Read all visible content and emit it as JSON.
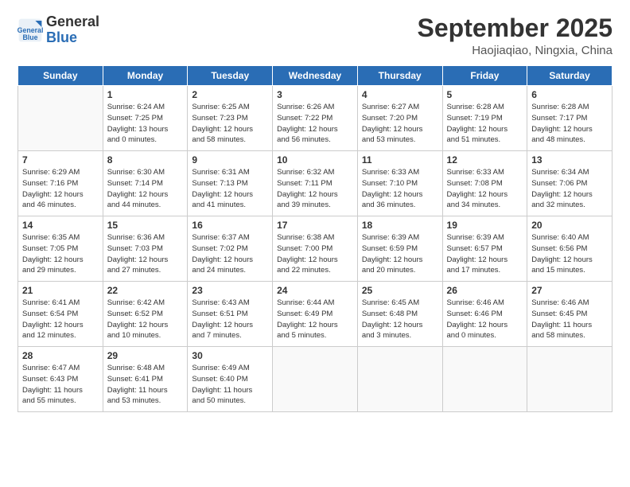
{
  "logo": {
    "line1": "General",
    "line2": "Blue"
  },
  "title": "September 2025",
  "subtitle": "Haojiaqiao, Ningxia, China",
  "days_of_week": [
    "Sunday",
    "Monday",
    "Tuesday",
    "Wednesday",
    "Thursday",
    "Friday",
    "Saturday"
  ],
  "weeks": [
    [
      {
        "day": "",
        "info": ""
      },
      {
        "day": "1",
        "info": "Sunrise: 6:24 AM\nSunset: 7:25 PM\nDaylight: 13 hours\nand 0 minutes."
      },
      {
        "day": "2",
        "info": "Sunrise: 6:25 AM\nSunset: 7:23 PM\nDaylight: 12 hours\nand 58 minutes."
      },
      {
        "day": "3",
        "info": "Sunrise: 6:26 AM\nSunset: 7:22 PM\nDaylight: 12 hours\nand 56 minutes."
      },
      {
        "day": "4",
        "info": "Sunrise: 6:27 AM\nSunset: 7:20 PM\nDaylight: 12 hours\nand 53 minutes."
      },
      {
        "day": "5",
        "info": "Sunrise: 6:28 AM\nSunset: 7:19 PM\nDaylight: 12 hours\nand 51 minutes."
      },
      {
        "day": "6",
        "info": "Sunrise: 6:28 AM\nSunset: 7:17 PM\nDaylight: 12 hours\nand 48 minutes."
      }
    ],
    [
      {
        "day": "7",
        "info": "Sunrise: 6:29 AM\nSunset: 7:16 PM\nDaylight: 12 hours\nand 46 minutes."
      },
      {
        "day": "8",
        "info": "Sunrise: 6:30 AM\nSunset: 7:14 PM\nDaylight: 12 hours\nand 44 minutes."
      },
      {
        "day": "9",
        "info": "Sunrise: 6:31 AM\nSunset: 7:13 PM\nDaylight: 12 hours\nand 41 minutes."
      },
      {
        "day": "10",
        "info": "Sunrise: 6:32 AM\nSunset: 7:11 PM\nDaylight: 12 hours\nand 39 minutes."
      },
      {
        "day": "11",
        "info": "Sunrise: 6:33 AM\nSunset: 7:10 PM\nDaylight: 12 hours\nand 36 minutes."
      },
      {
        "day": "12",
        "info": "Sunrise: 6:33 AM\nSunset: 7:08 PM\nDaylight: 12 hours\nand 34 minutes."
      },
      {
        "day": "13",
        "info": "Sunrise: 6:34 AM\nSunset: 7:06 PM\nDaylight: 12 hours\nand 32 minutes."
      }
    ],
    [
      {
        "day": "14",
        "info": "Sunrise: 6:35 AM\nSunset: 7:05 PM\nDaylight: 12 hours\nand 29 minutes."
      },
      {
        "day": "15",
        "info": "Sunrise: 6:36 AM\nSunset: 7:03 PM\nDaylight: 12 hours\nand 27 minutes."
      },
      {
        "day": "16",
        "info": "Sunrise: 6:37 AM\nSunset: 7:02 PM\nDaylight: 12 hours\nand 24 minutes."
      },
      {
        "day": "17",
        "info": "Sunrise: 6:38 AM\nSunset: 7:00 PM\nDaylight: 12 hours\nand 22 minutes."
      },
      {
        "day": "18",
        "info": "Sunrise: 6:39 AM\nSunset: 6:59 PM\nDaylight: 12 hours\nand 20 minutes."
      },
      {
        "day": "19",
        "info": "Sunrise: 6:39 AM\nSunset: 6:57 PM\nDaylight: 12 hours\nand 17 minutes."
      },
      {
        "day": "20",
        "info": "Sunrise: 6:40 AM\nSunset: 6:56 PM\nDaylight: 12 hours\nand 15 minutes."
      }
    ],
    [
      {
        "day": "21",
        "info": "Sunrise: 6:41 AM\nSunset: 6:54 PM\nDaylight: 12 hours\nand 12 minutes."
      },
      {
        "day": "22",
        "info": "Sunrise: 6:42 AM\nSunset: 6:52 PM\nDaylight: 12 hours\nand 10 minutes."
      },
      {
        "day": "23",
        "info": "Sunrise: 6:43 AM\nSunset: 6:51 PM\nDaylight: 12 hours\nand 7 minutes."
      },
      {
        "day": "24",
        "info": "Sunrise: 6:44 AM\nSunset: 6:49 PM\nDaylight: 12 hours\nand 5 minutes."
      },
      {
        "day": "25",
        "info": "Sunrise: 6:45 AM\nSunset: 6:48 PM\nDaylight: 12 hours\nand 3 minutes."
      },
      {
        "day": "26",
        "info": "Sunrise: 6:46 AM\nSunset: 6:46 PM\nDaylight: 12 hours\nand 0 minutes."
      },
      {
        "day": "27",
        "info": "Sunrise: 6:46 AM\nSunset: 6:45 PM\nDaylight: 11 hours\nand 58 minutes."
      }
    ],
    [
      {
        "day": "28",
        "info": "Sunrise: 6:47 AM\nSunset: 6:43 PM\nDaylight: 11 hours\nand 55 minutes."
      },
      {
        "day": "29",
        "info": "Sunrise: 6:48 AM\nSunset: 6:41 PM\nDaylight: 11 hours\nand 53 minutes."
      },
      {
        "day": "30",
        "info": "Sunrise: 6:49 AM\nSunset: 6:40 PM\nDaylight: 11 hours\nand 50 minutes."
      },
      {
        "day": "",
        "info": ""
      },
      {
        "day": "",
        "info": ""
      },
      {
        "day": "",
        "info": ""
      },
      {
        "day": "",
        "info": ""
      }
    ]
  ]
}
